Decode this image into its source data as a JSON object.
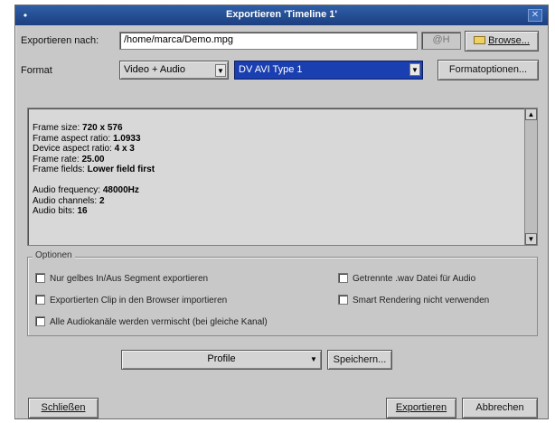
{
  "window": {
    "title": "Exportieren 'Timeline 1'",
    "menu_glyph": "•",
    "close_glyph": "✕"
  },
  "export_to": {
    "label": "Exportieren nach:",
    "path": "/home/marca/Demo.mpg",
    "ext": "@H",
    "browse_label": "Browse..."
  },
  "format": {
    "label": "Format",
    "type_value": "Video + Audio",
    "codec_value": "DV AVI Type 1",
    "options_button": "Formatoptionen..."
  },
  "info": {
    "lines": [
      {
        "label": "Frame size:",
        "value": "720 x 576"
      },
      {
        "label": "Frame aspect ratio:",
        "value": "1.0933"
      },
      {
        "label": "Device aspect ratio:",
        "value": "4 x 3"
      },
      {
        "label": "Frame rate:",
        "value": "25.00"
      },
      {
        "label": "Frame fields:",
        "value": "Lower field first"
      },
      {
        "label": "",
        "value": ""
      },
      {
        "label": "Audio frequency:",
        "value": "48000Hz"
      },
      {
        "label": "Audio channels:",
        "value": "2"
      },
      {
        "label": "Audio bits:",
        "value": "16"
      }
    ]
  },
  "options": {
    "legend": "Optionen",
    "checkboxes": [
      "Nur gelbes In/Aus Segment exportieren",
      "Exportierten Clip in den Browser importieren",
      "Alle Audiokanäle werden vermischt (bei gleiche Kanal)",
      "Getrennte .wav Datei für Audio",
      "Smart Rendering nicht verwenden"
    ]
  },
  "profile": {
    "value": "Profile",
    "save_label": "Speichern..."
  },
  "footer": {
    "close_label": "Schließen",
    "export_label": "Exportieren",
    "cancel_label": "Abbrechen"
  }
}
